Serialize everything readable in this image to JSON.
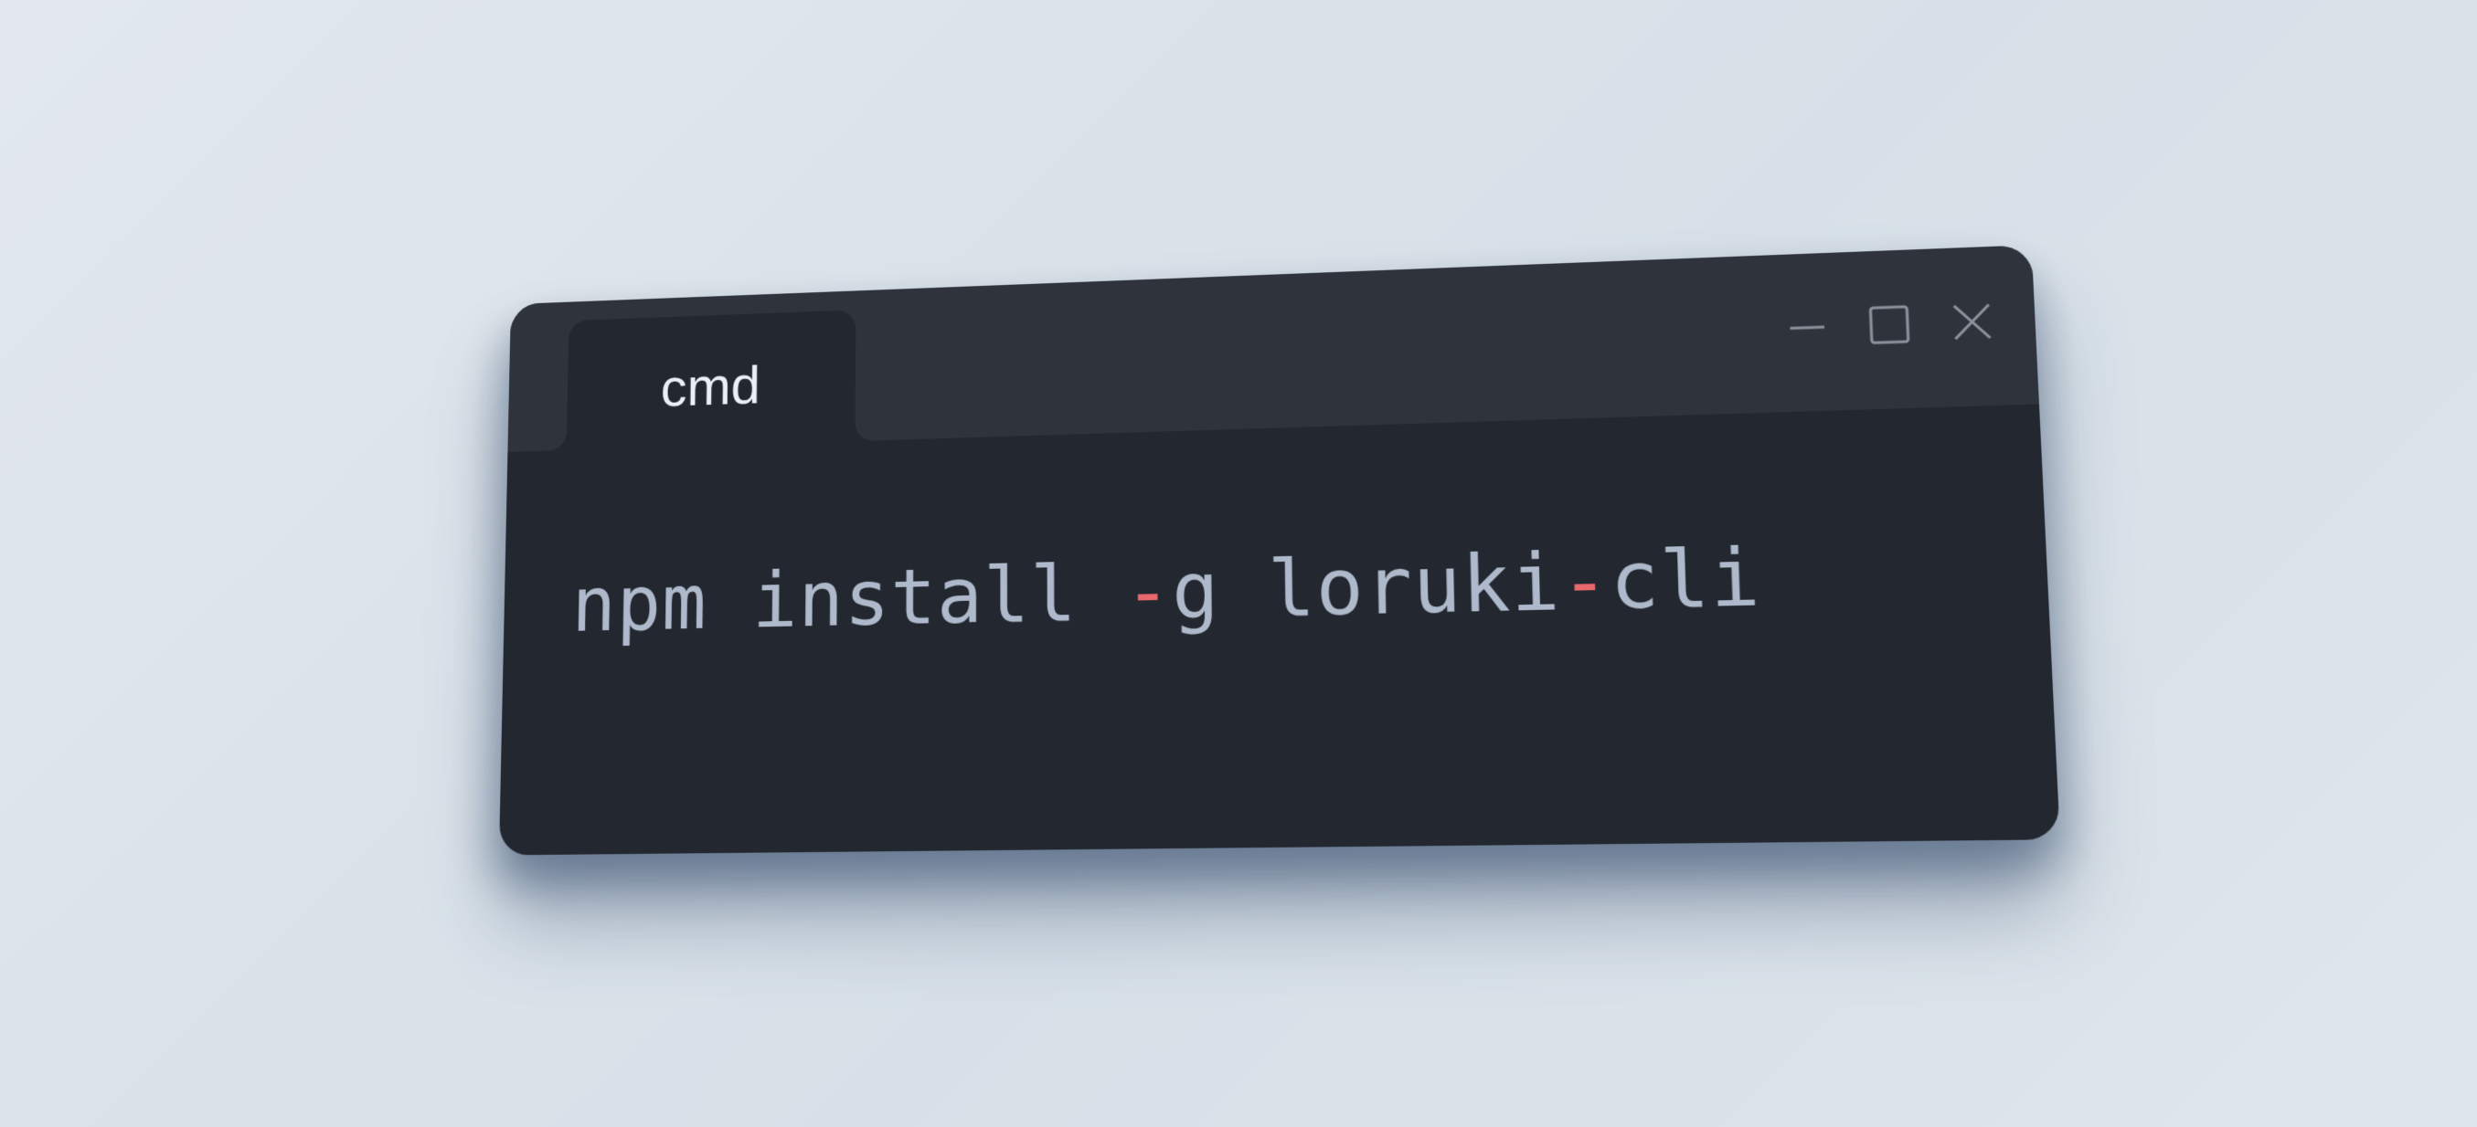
{
  "window": {
    "tab_label": "cmd",
    "controls": [
      {
        "name": "minimize",
        "icon": "minimize-icon"
      },
      {
        "name": "maximize",
        "icon": "maximize-icon"
      },
      {
        "name": "close",
        "icon": "close-icon"
      }
    ]
  },
  "terminal": {
    "command_part1": "npm install ",
    "flag_dash": "-",
    "command_part2": "g loruki",
    "name_dash": "-",
    "command_part3": "cli"
  },
  "colors": {
    "background": "#dce4eb",
    "window_body": "#23272f",
    "titlebar": "#2f333c",
    "command_text": "#aebacb",
    "dash_accent": "#e8696c",
    "tab_text": "#eceff3",
    "control_icons": "#8d939c"
  }
}
